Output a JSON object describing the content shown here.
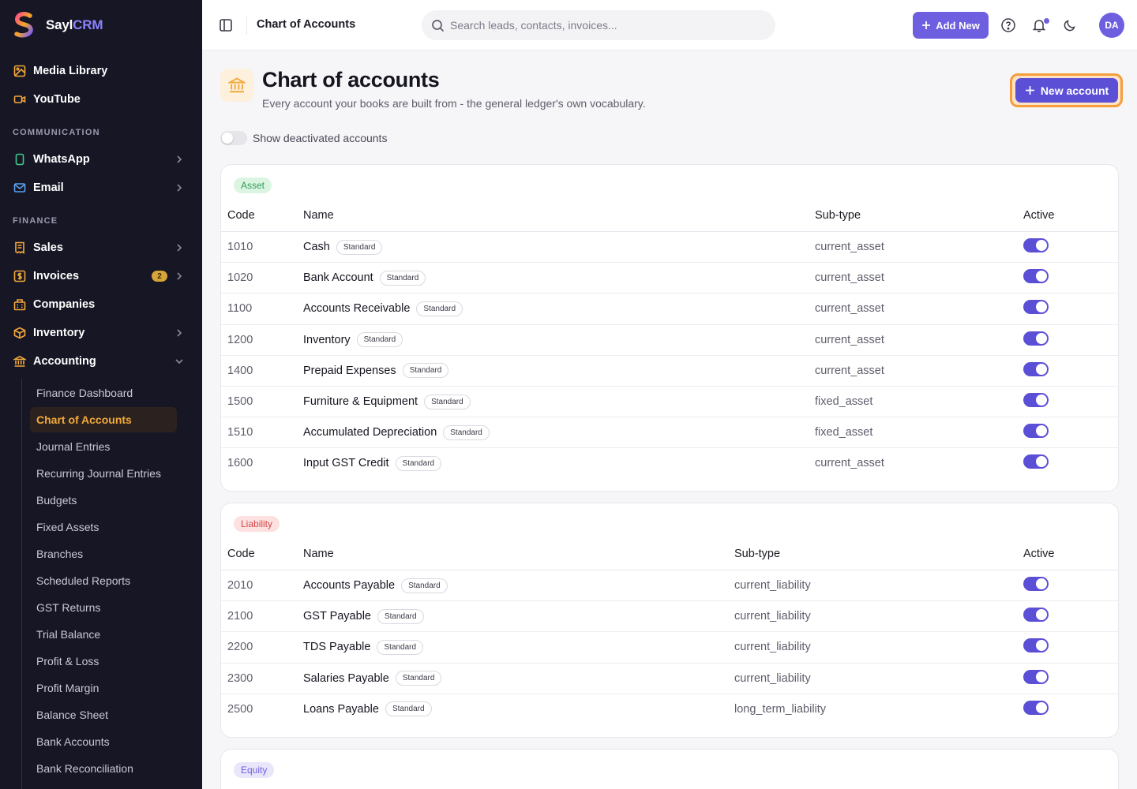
{
  "brand": {
    "name_part1": "Sayl",
    "name_part2": "CRM"
  },
  "sidebar": {
    "top_items": [
      {
        "label": "Media Library",
        "icon": "image-icon"
      },
      {
        "label": "YouTube",
        "icon": "video-icon"
      }
    ],
    "sections": [
      {
        "label": "COMMUNICATION"
      },
      {
        "label": "FINANCE"
      }
    ],
    "communication_items": [
      {
        "label": "WhatsApp",
        "icon": "phone-icon"
      },
      {
        "label": "Email",
        "icon": "mail-icon"
      }
    ],
    "finance_items": [
      {
        "label": "Sales",
        "icon": "receipt-icon"
      },
      {
        "label": "Invoices",
        "icon": "dollar-icon",
        "badge": "2"
      },
      {
        "label": "Companies",
        "icon": "building-icon"
      },
      {
        "label": "Inventory",
        "icon": "box-icon"
      },
      {
        "label": "Accounting",
        "icon": "bank-icon"
      }
    ],
    "accounting_sub": [
      "Finance Dashboard",
      "Chart of Accounts",
      "Journal Entries",
      "Recurring Journal Entries",
      "Budgets",
      "Fixed Assets",
      "Branches",
      "Scheduled Reports",
      "GST Returns",
      "Trial Balance",
      "Profit & Loss",
      "Profit Margin",
      "Balance Sheet",
      "Bank Accounts",
      "Bank Reconciliation"
    ],
    "active_sub": "Chart of Accounts"
  },
  "topbar": {
    "title": "Chart of Accounts",
    "search_placeholder": "Search leads, contacts, invoices...",
    "add_new_label": "Add New",
    "avatar_initials": "DA"
  },
  "page": {
    "title": "Chart of accounts",
    "subtitle": "Every account your books are built from - the general ledger's own vocabulary.",
    "new_account_label": "New account",
    "show_deactivated_label": "Show deactivated accounts",
    "show_deactivated_on": false
  },
  "columns": {
    "code": "Code",
    "name": "Name",
    "subtype": "Sub-type",
    "active": "Active"
  },
  "groups": [
    {
      "type": "Asset",
      "badge_bg": "#dcf5e3",
      "badge_fg": "#2f9a55",
      "accounts": [
        {
          "code": "1010",
          "name": "Cash",
          "tag": "Standard",
          "subtype": "current_asset",
          "active": true
        },
        {
          "code": "1020",
          "name": "Bank Account",
          "tag": "Standard",
          "subtype": "current_asset",
          "active": true
        },
        {
          "code": "1100",
          "name": "Accounts Receivable",
          "tag": "Standard",
          "subtype": "current_asset",
          "active": true
        },
        {
          "code": "1200",
          "name": "Inventory",
          "tag": "Standard",
          "subtype": "current_asset",
          "active": true
        },
        {
          "code": "1400",
          "name": "Prepaid Expenses",
          "tag": "Standard",
          "subtype": "current_asset",
          "active": true
        },
        {
          "code": "1500",
          "name": "Furniture & Equipment",
          "tag": "Standard",
          "subtype": "fixed_asset",
          "active": true
        },
        {
          "code": "1510",
          "name": "Accumulated Depreciation",
          "tag": "Standard",
          "subtype": "fixed_asset",
          "active": true
        },
        {
          "code": "1600",
          "name": "Input GST Credit",
          "tag": "Standard",
          "subtype": "current_asset",
          "active": true
        }
      ]
    },
    {
      "type": "Liability",
      "badge_bg": "#fde0e0",
      "badge_fg": "#d44848",
      "accounts": [
        {
          "code": "2010",
          "name": "Accounts Payable",
          "tag": "Standard",
          "subtype": "current_liability",
          "active": true
        },
        {
          "code": "2100",
          "name": "GST Payable",
          "tag": "Standard",
          "subtype": "current_liability",
          "active": true
        },
        {
          "code": "2200",
          "name": "TDS Payable",
          "tag": "Standard",
          "subtype": "current_liability",
          "active": true
        },
        {
          "code": "2300",
          "name": "Salaries Payable",
          "tag": "Standard",
          "subtype": "current_liability",
          "active": true
        },
        {
          "code": "2500",
          "name": "Loans Payable",
          "tag": "Standard",
          "subtype": "long_term_liability",
          "active": true
        }
      ]
    },
    {
      "type": "Equity",
      "badge_bg": "#e9e6fb",
      "badge_fg": "#6e5fe0",
      "accounts": []
    }
  ],
  "colors": {
    "accent": "#5b4fd6",
    "sidebar_bg": "#161625",
    "active_orange": "#f2a93b"
  }
}
